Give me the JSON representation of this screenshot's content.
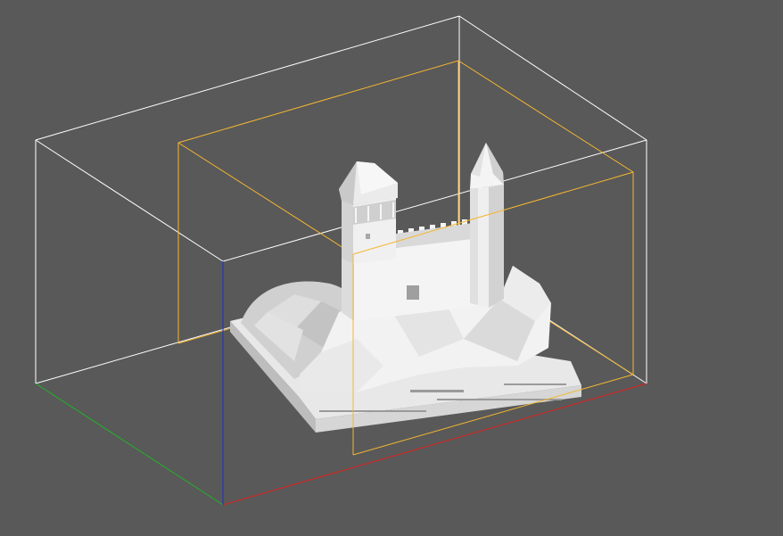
{
  "viewport": {
    "background": "#595959",
    "model_name": "castle-on-hill"
  },
  "colors": {
    "build_volume": "#ffffff",
    "model_bounding_box": "#f5b731",
    "axis_x": "#e0201c",
    "axis_y": "#22b22a",
    "axis_z": "#1d2fc8",
    "model_light": "#ffffff",
    "model_mid": "#e6e6e6",
    "model_shadow": "#c6c6c6",
    "model_dark": "#a9a9a9"
  },
  "icons": [
    "axis-gizmo-icon"
  ]
}
